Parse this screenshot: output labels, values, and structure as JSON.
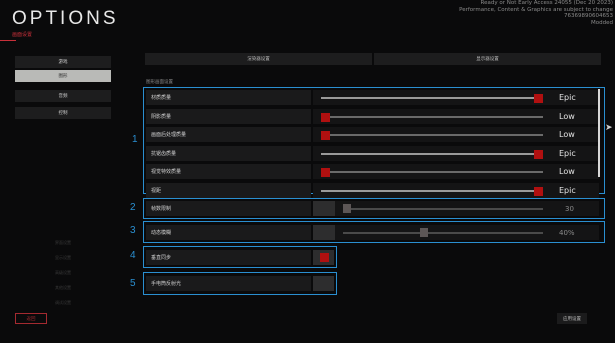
{
  "header": {
    "title": "OPTIONS",
    "subtitle": "画面设置",
    "version_lines": [
      "Ready or Not Early Access 24055 (Dec 20 2023)",
      "Performance, Content & Graphics are subject to change",
      "76369890604653",
      "Modded"
    ]
  },
  "sidebar": {
    "items": [
      {
        "label": "游戏"
      },
      {
        "label": "图形"
      },
      {
        "label": "音频"
      },
      {
        "label": "控制"
      }
    ],
    "ghost_items": [
      "界面设置",
      "显示设置",
      "高级设置",
      "其他设置",
      "调试设置"
    ],
    "back_label": "返回"
  },
  "tabs": {
    "left": "渲染器设置",
    "right": "显示器设置"
  },
  "section": {
    "label": "图形画面设置"
  },
  "quality_rows": [
    {
      "label": "材质质量",
      "value": "Epic",
      "level": 1.0
    },
    {
      "label": "阴影质量",
      "value": "Low",
      "level": 0.0
    },
    {
      "label": "画面后处理质量",
      "value": "Low",
      "level": 0.0
    },
    {
      "label": "抗锯齿质量",
      "value": "Epic",
      "level": 1.0
    },
    {
      "label": "视觉特效质量",
      "value": "Low",
      "level": 0.0
    },
    {
      "label": "视距",
      "value": "Epic",
      "level": 1.0
    }
  ],
  "fps_limit": {
    "label": "帧数限制",
    "value": "30",
    "level": 0.0
  },
  "motion_blur": {
    "label": "动态模糊",
    "value": "40%",
    "level": 0.4
  },
  "vsync": {
    "label": "垂直同步",
    "checked": true
  },
  "flashlight": {
    "label": "手电筒反射光"
  },
  "markers": [
    "1",
    "2",
    "3",
    "4",
    "5"
  ],
  "apply_label": "应用设置",
  "colors": {
    "accent_blue": "#2a8fd1",
    "accent_red": "#b01010"
  }
}
